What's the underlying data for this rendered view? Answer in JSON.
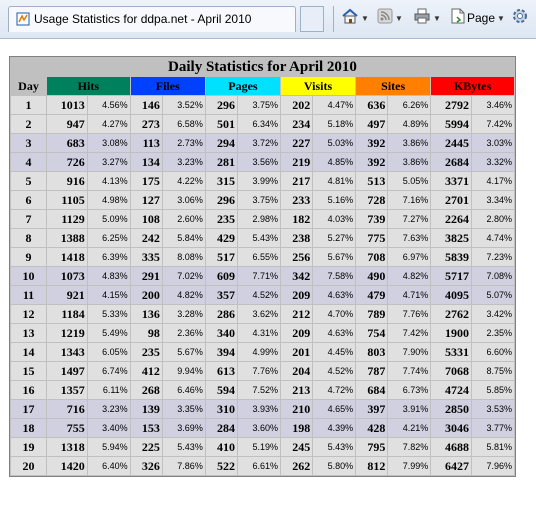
{
  "browser": {
    "tab_title": "Usage Statistics for ddpa.net - April 2010",
    "page_menu_label": "Page",
    "toolbar_icons": [
      "home-icon",
      "feeds-icon",
      "print-icon",
      "page-icon",
      "tools-icon"
    ]
  },
  "stats": {
    "title": "Daily Statistics for April 2010",
    "headers": {
      "day": "Day",
      "hits": "Hits",
      "files": "Files",
      "pages": "Pages",
      "visits": "Visits",
      "sites": "Sites",
      "kbytes": "KBytes"
    },
    "colors": {
      "hits": "#00805c",
      "files": "#0040ff",
      "pages": "#00e0ff",
      "visits": "#ffff00",
      "sites": "#ff8000",
      "kbytes": "#ff0000"
    },
    "rows": [
      {
        "day": "1",
        "weekend": false,
        "hits": "1013",
        "hits_pct": "4.56%",
        "files": "146",
        "files_pct": "3.52%",
        "pages": "296",
        "pages_pct": "3.75%",
        "visits": "202",
        "visits_pct": "4.47%",
        "sites": "636",
        "sites_pct": "6.26%",
        "kbytes": "2792",
        "kbytes_pct": "3.46%"
      },
      {
        "day": "2",
        "weekend": false,
        "hits": "947",
        "hits_pct": "4.27%",
        "files": "273",
        "files_pct": "6.58%",
        "pages": "501",
        "pages_pct": "6.34%",
        "visits": "234",
        "visits_pct": "5.18%",
        "sites": "497",
        "sites_pct": "4.89%",
        "kbytes": "5994",
        "kbytes_pct": "7.42%"
      },
      {
        "day": "3",
        "weekend": true,
        "hits": "683",
        "hits_pct": "3.08%",
        "files": "113",
        "files_pct": "2.73%",
        "pages": "294",
        "pages_pct": "3.72%",
        "visits": "227",
        "visits_pct": "5.03%",
        "sites": "392",
        "sites_pct": "3.86%",
        "kbytes": "2445",
        "kbytes_pct": "3.03%"
      },
      {
        "day": "4",
        "weekend": true,
        "hits": "726",
        "hits_pct": "3.27%",
        "files": "134",
        "files_pct": "3.23%",
        "pages": "281",
        "pages_pct": "3.56%",
        "visits": "219",
        "visits_pct": "4.85%",
        "sites": "392",
        "sites_pct": "3.86%",
        "kbytes": "2684",
        "kbytes_pct": "3.32%"
      },
      {
        "day": "5",
        "weekend": false,
        "hits": "916",
        "hits_pct": "4.13%",
        "files": "175",
        "files_pct": "4.22%",
        "pages": "315",
        "pages_pct": "3.99%",
        "visits": "217",
        "visits_pct": "4.81%",
        "sites": "513",
        "sites_pct": "5.05%",
        "kbytes": "3371",
        "kbytes_pct": "4.17%"
      },
      {
        "day": "6",
        "weekend": false,
        "hits": "1105",
        "hits_pct": "4.98%",
        "files": "127",
        "files_pct": "3.06%",
        "pages": "296",
        "pages_pct": "3.75%",
        "visits": "233",
        "visits_pct": "5.16%",
        "sites": "728",
        "sites_pct": "7.16%",
        "kbytes": "2701",
        "kbytes_pct": "3.34%"
      },
      {
        "day": "7",
        "weekend": false,
        "hits": "1129",
        "hits_pct": "5.09%",
        "files": "108",
        "files_pct": "2.60%",
        "pages": "235",
        "pages_pct": "2.98%",
        "visits": "182",
        "visits_pct": "4.03%",
        "sites": "739",
        "sites_pct": "7.27%",
        "kbytes": "2264",
        "kbytes_pct": "2.80%"
      },
      {
        "day": "8",
        "weekend": false,
        "hits": "1388",
        "hits_pct": "6.25%",
        "files": "242",
        "files_pct": "5.84%",
        "pages": "429",
        "pages_pct": "5.43%",
        "visits": "238",
        "visits_pct": "5.27%",
        "sites": "775",
        "sites_pct": "7.63%",
        "kbytes": "3825",
        "kbytes_pct": "4.74%"
      },
      {
        "day": "9",
        "weekend": false,
        "hits": "1418",
        "hits_pct": "6.39%",
        "files": "335",
        "files_pct": "8.08%",
        "pages": "517",
        "pages_pct": "6.55%",
        "visits": "256",
        "visits_pct": "5.67%",
        "sites": "708",
        "sites_pct": "6.97%",
        "kbytes": "5839",
        "kbytes_pct": "7.23%"
      },
      {
        "day": "10",
        "weekend": true,
        "hits": "1073",
        "hits_pct": "4.83%",
        "files": "291",
        "files_pct": "7.02%",
        "pages": "609",
        "pages_pct": "7.71%",
        "visits": "342",
        "visits_pct": "7.58%",
        "sites": "490",
        "sites_pct": "4.82%",
        "kbytes": "5717",
        "kbytes_pct": "7.08%"
      },
      {
        "day": "11",
        "weekend": true,
        "hits": "921",
        "hits_pct": "4.15%",
        "files": "200",
        "files_pct": "4.82%",
        "pages": "357",
        "pages_pct": "4.52%",
        "visits": "209",
        "visits_pct": "4.63%",
        "sites": "479",
        "sites_pct": "4.71%",
        "kbytes": "4095",
        "kbytes_pct": "5.07%"
      },
      {
        "day": "12",
        "weekend": false,
        "hits": "1184",
        "hits_pct": "5.33%",
        "files": "136",
        "files_pct": "3.28%",
        "pages": "286",
        "pages_pct": "3.62%",
        "visits": "212",
        "visits_pct": "4.70%",
        "sites": "789",
        "sites_pct": "7.76%",
        "kbytes": "2762",
        "kbytes_pct": "3.42%"
      },
      {
        "day": "13",
        "weekend": false,
        "hits": "1219",
        "hits_pct": "5.49%",
        "files": "98",
        "files_pct": "2.36%",
        "pages": "340",
        "pages_pct": "4.31%",
        "visits": "209",
        "visits_pct": "4.63%",
        "sites": "754",
        "sites_pct": "7.42%",
        "kbytes": "1900",
        "kbytes_pct": "2.35%"
      },
      {
        "day": "14",
        "weekend": false,
        "hits": "1343",
        "hits_pct": "6.05%",
        "files": "235",
        "files_pct": "5.67%",
        "pages": "394",
        "pages_pct": "4.99%",
        "visits": "201",
        "visits_pct": "4.45%",
        "sites": "803",
        "sites_pct": "7.90%",
        "kbytes": "5331",
        "kbytes_pct": "6.60%"
      },
      {
        "day": "15",
        "weekend": false,
        "hits": "1497",
        "hits_pct": "6.74%",
        "files": "412",
        "files_pct": "9.94%",
        "pages": "613",
        "pages_pct": "7.76%",
        "visits": "204",
        "visits_pct": "4.52%",
        "sites": "787",
        "sites_pct": "7.74%",
        "kbytes": "7068",
        "kbytes_pct": "8.75%"
      },
      {
        "day": "16",
        "weekend": false,
        "hits": "1357",
        "hits_pct": "6.11%",
        "files": "268",
        "files_pct": "6.46%",
        "pages": "594",
        "pages_pct": "7.52%",
        "visits": "213",
        "visits_pct": "4.72%",
        "sites": "684",
        "sites_pct": "6.73%",
        "kbytes": "4724",
        "kbytes_pct": "5.85%"
      },
      {
        "day": "17",
        "weekend": true,
        "hits": "716",
        "hits_pct": "3.23%",
        "files": "139",
        "files_pct": "3.35%",
        "pages": "310",
        "pages_pct": "3.93%",
        "visits": "210",
        "visits_pct": "4.65%",
        "sites": "397",
        "sites_pct": "3.91%",
        "kbytes": "2850",
        "kbytes_pct": "3.53%"
      },
      {
        "day": "18",
        "weekend": true,
        "hits": "755",
        "hits_pct": "3.40%",
        "files": "153",
        "files_pct": "3.69%",
        "pages": "284",
        "pages_pct": "3.60%",
        "visits": "198",
        "visits_pct": "4.39%",
        "sites": "428",
        "sites_pct": "4.21%",
        "kbytes": "3046",
        "kbytes_pct": "3.77%"
      },
      {
        "day": "19",
        "weekend": false,
        "hits": "1318",
        "hits_pct": "5.94%",
        "files": "225",
        "files_pct": "5.43%",
        "pages": "410",
        "pages_pct": "5.19%",
        "visits": "245",
        "visits_pct": "5.43%",
        "sites": "795",
        "sites_pct": "7.82%",
        "kbytes": "4688",
        "kbytes_pct": "5.81%"
      },
      {
        "day": "20",
        "weekend": false,
        "hits": "1420",
        "hits_pct": "6.40%",
        "files": "326",
        "files_pct": "7.86%",
        "pages": "522",
        "pages_pct": "6.61%",
        "visits": "262",
        "visits_pct": "5.80%",
        "sites": "812",
        "sites_pct": "7.99%",
        "kbytes": "6427",
        "kbytes_pct": "7.96%"
      }
    ]
  }
}
